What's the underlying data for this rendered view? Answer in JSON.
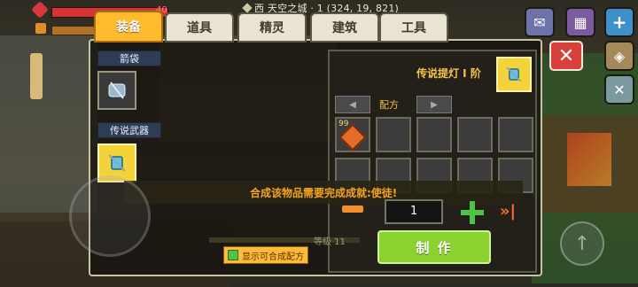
{
  "hud": {
    "hp_value": "40",
    "location": "西  天空之城 · 1 (324, 19, 821)"
  },
  "tabs": [
    {
      "label": "装备",
      "active": true
    },
    {
      "label": "道具",
      "active": false
    },
    {
      "label": "精灵",
      "active": false
    },
    {
      "label": "建筑",
      "active": false
    },
    {
      "label": "工具",
      "active": false
    }
  ],
  "categories": {
    "quiver_label": "箭袋",
    "legend_label": "传说武器"
  },
  "recipe": {
    "title": "传说提灯 Ⅰ 阶",
    "label": "配方",
    "ingredient_count": "99",
    "requirement": "合成该物品需要完成成就:使徒!",
    "quantity": "1",
    "make_label": "制 作",
    "max_label": "»|"
  },
  "bottom": {
    "show_craftable": "显示可合成配方",
    "xp_text": "等级 11"
  },
  "colors": {
    "active_tab": "#ffba2e",
    "make_button": "#8bd12f",
    "requirement_text": "#f4a41e",
    "close_button": "#d8403c"
  },
  "icons": [
    "heart-icon",
    "food-icon",
    "chat-icon",
    "shop-icon",
    "plus-icon",
    "cube-icon",
    "tools-icon",
    "close-icon",
    "quiver-icon",
    "lantern-icon",
    "ore-icon",
    "minus-icon",
    "add-icon",
    "max-icon",
    "jump-icon"
  ]
}
